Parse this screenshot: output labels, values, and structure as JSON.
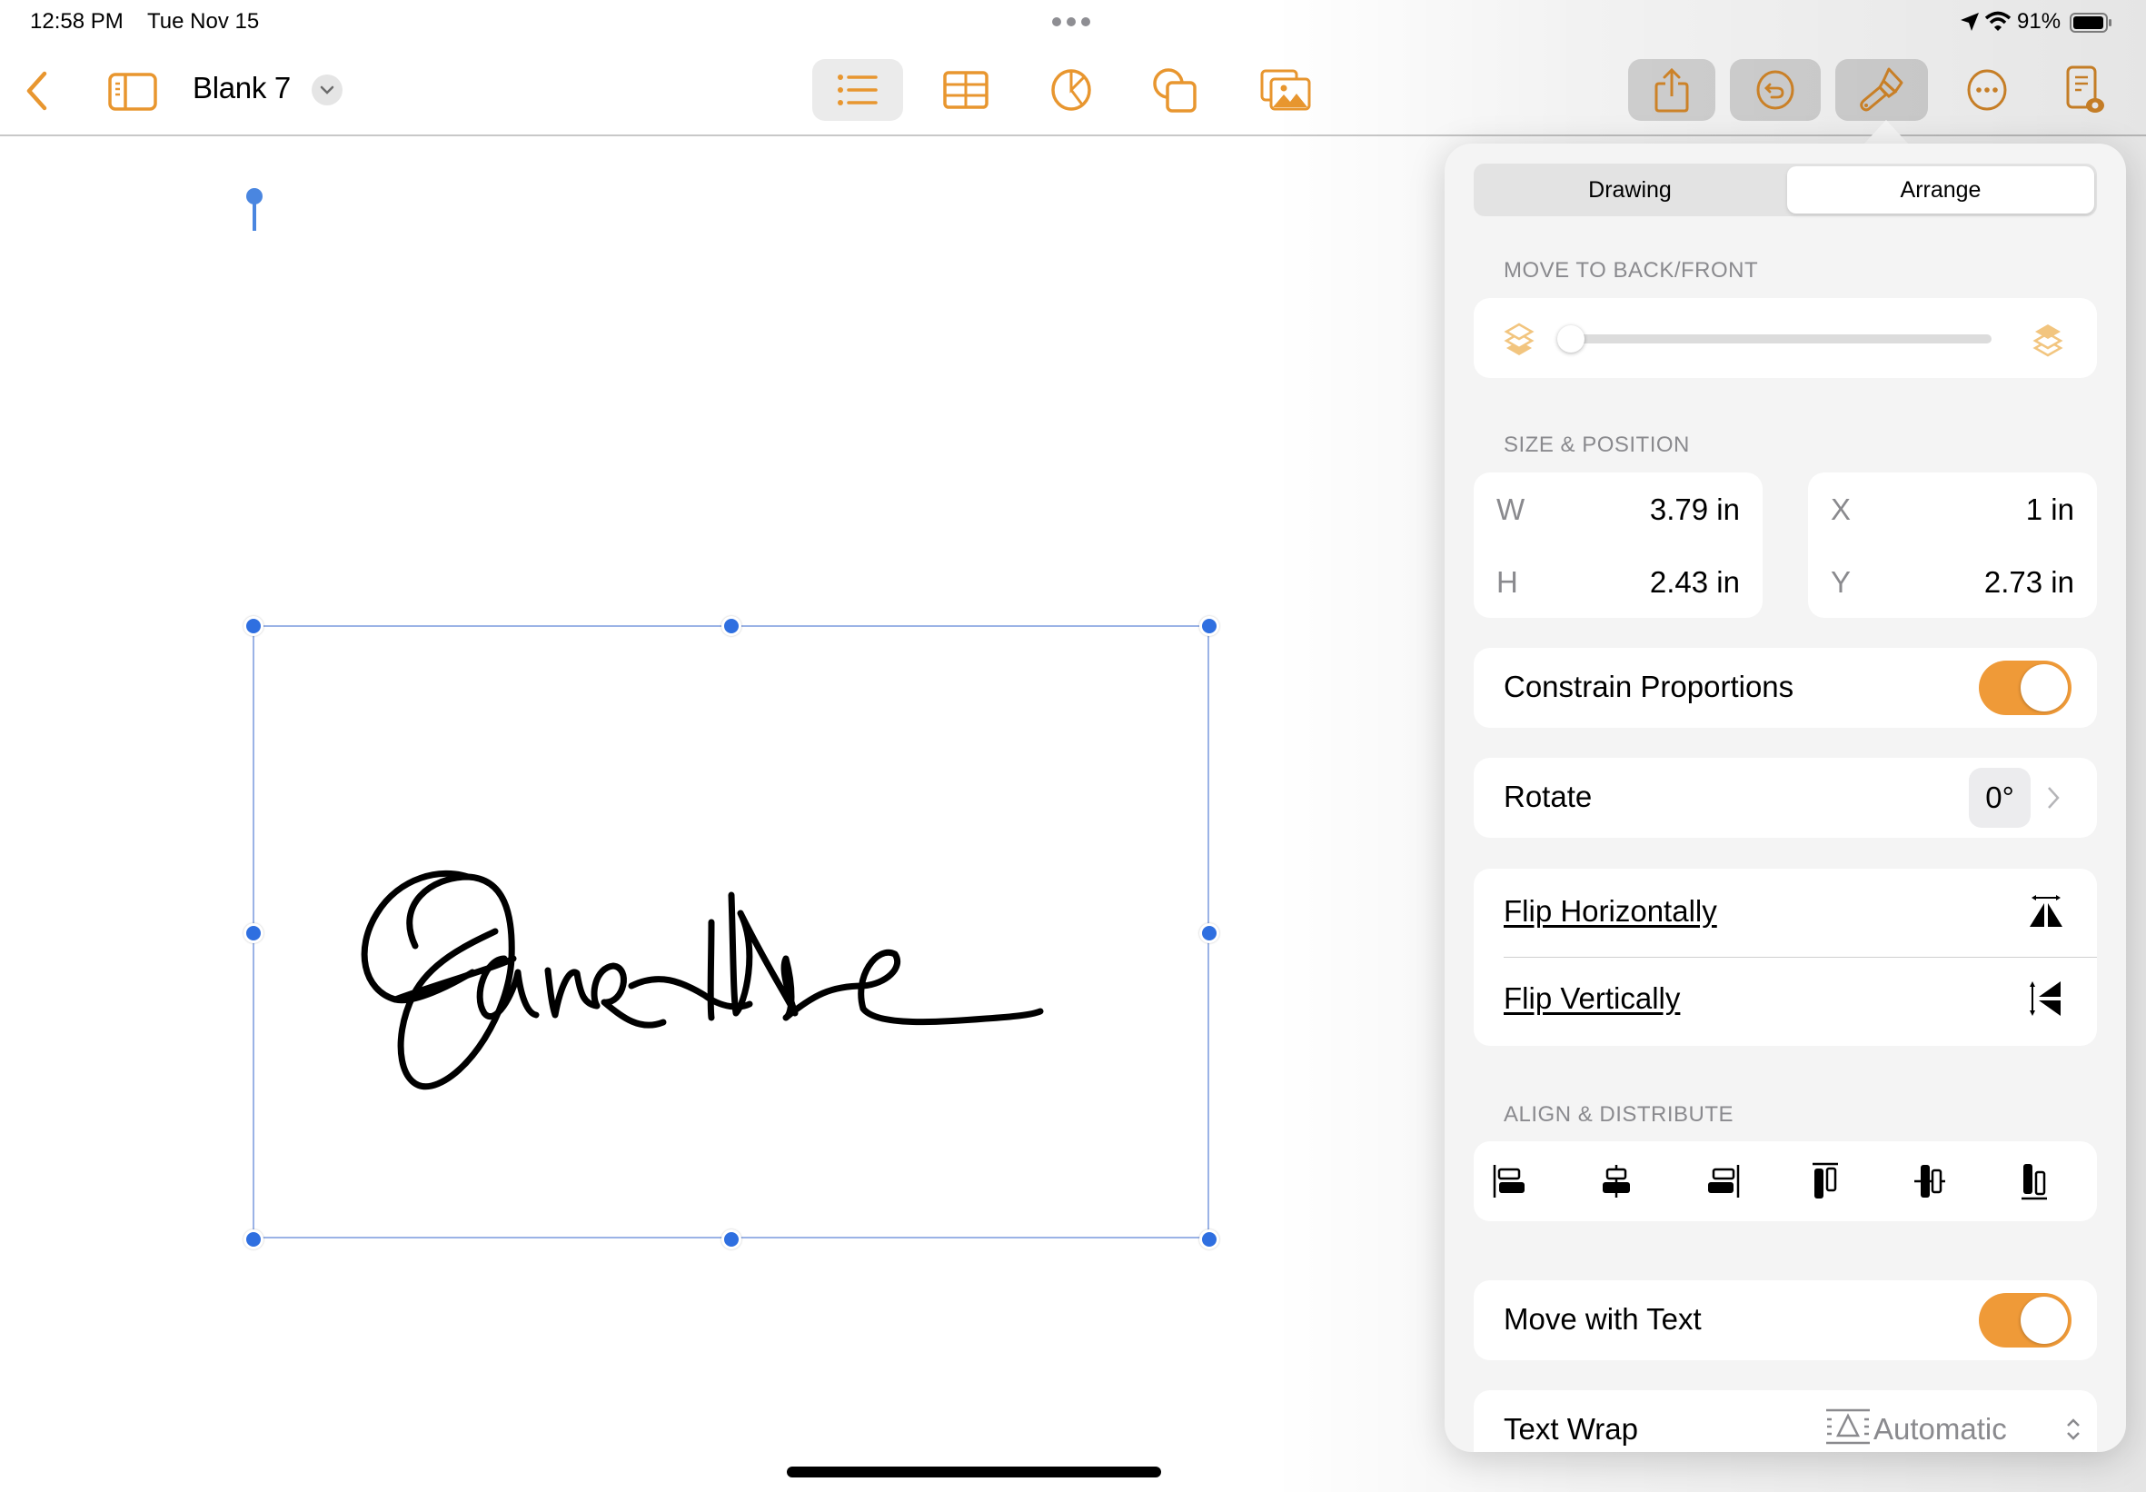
{
  "status_bar": {
    "time": "12:58 PM",
    "date": "Tue Nov 15",
    "battery": "91%",
    "multitask_icon": "three-dots",
    "icons": [
      "location-arrow-icon",
      "wifi-icon",
      "battery-icon"
    ]
  },
  "toolbar": {
    "document_title": "Blank 7",
    "left_icons": [
      "back-chevron-icon",
      "sidebar-icon",
      "title-dropdown-icon"
    ],
    "center_icons": [
      "list-icon",
      "table-icon",
      "chart-icon",
      "shapes-icon",
      "media-icon"
    ],
    "right_icons": [
      "share-icon",
      "undo-icon",
      "format-paintbrush-icon",
      "more-icon",
      "reader-view-icon"
    ],
    "accent_color": "#e8962f"
  },
  "canvas": {
    "object": "handwritten signature drawing",
    "signature_text": "Jane Doe",
    "selection_color": "#2f6fe0"
  },
  "panel": {
    "tabs": [
      {
        "label": "Drawing",
        "selected": false
      },
      {
        "label": "Arrange",
        "selected": true
      }
    ],
    "move_to_back_front": {
      "label": "MOVE TO BACK/FRONT",
      "slider_value": 0,
      "left_icon": "send-to-back-icon",
      "right_icon": "bring-to-front-icon"
    },
    "size_position": {
      "label": "SIZE & POSITION",
      "w_label": "W",
      "w_value": "3.79 in",
      "h_label": "H",
      "h_value": "2.43 in",
      "x_label": "X",
      "x_value": "1 in",
      "y_label": "Y",
      "y_value": "2.73 in"
    },
    "constrain_proportions": {
      "label": "Constrain Proportions",
      "on": true
    },
    "rotate": {
      "label": "Rotate",
      "value": "0°"
    },
    "flip_horizontally": "Flip Horizontally",
    "flip_vertically": "Flip Vertically",
    "align_distribute": {
      "label": "ALIGN & DISTRIBUTE",
      "buttons": [
        "align-left-icon",
        "align-center-icon",
        "align-right-icon",
        "align-top-icon",
        "align-middle-icon",
        "align-bottom-icon"
      ]
    },
    "move_with_text": {
      "label": "Move with Text",
      "on": true
    },
    "text_wrap": {
      "label": "Text Wrap",
      "value": "Automatic"
    }
  }
}
